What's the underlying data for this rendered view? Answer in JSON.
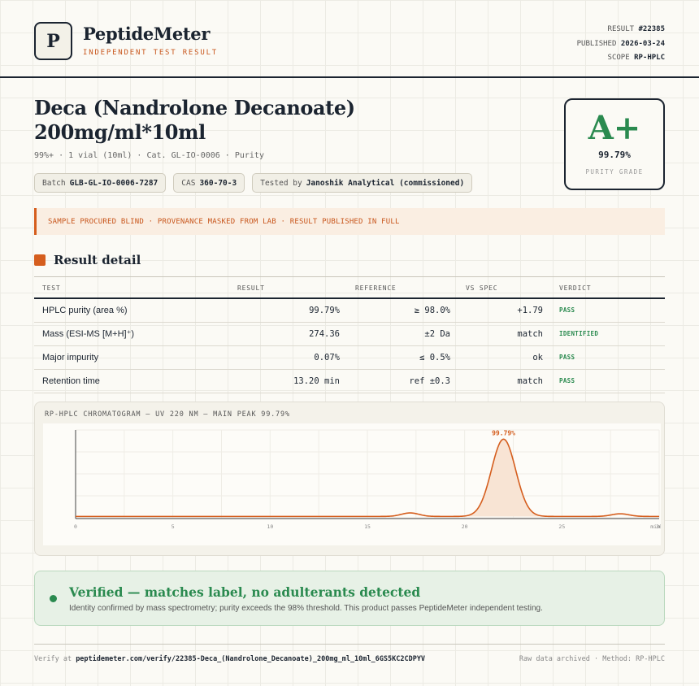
{
  "brand": {
    "logo_letter": "P",
    "name": "PeptideMeter",
    "subtitle": "INDEPENDENT TEST RESULT"
  },
  "meta": {
    "result_label": "RESULT",
    "result_value": "#22385",
    "published_label": "PUBLISHED",
    "published_value": "2026-03-24",
    "scope_label": "SCOPE",
    "scope_value": "RP-HPLC"
  },
  "product": {
    "title_line1": "Deca (Nandrolone Decanoate)",
    "title_line2": "200mg/ml*10ml",
    "subline": "99%+ · 1 vial (10ml) · Cat. GL-IO-0006 · Purity"
  },
  "chips": {
    "batch_label": "Batch",
    "batch_value": "GLB-GL-IO-0006-7287",
    "cas_label": "CAS",
    "cas_value": "360-70-3",
    "tested_label": "Tested by",
    "tested_value": "Janoshik Analytical (commissioned)"
  },
  "grade": {
    "letter": "A+",
    "value": "99.79%",
    "label": "PURITY GRADE",
    "color": "#2a8a4f"
  },
  "notice": "SAMPLE PROCURED BLIND · PROVENANCE MASKED FROM LAB · RESULT PUBLISHED IN FULL",
  "section_title": "Result detail",
  "table": {
    "headers": {
      "test": "TEST",
      "result": "RESULT",
      "reference": "REFERENCE",
      "vs_spec": "VS SPEC",
      "verdict": "VERDICT"
    },
    "rows": [
      {
        "test": "HPLC purity (area %)",
        "result": "99.79%",
        "reference": "≥ 98.0%",
        "vs_spec": "+1.79",
        "verdict": "PASS"
      },
      {
        "test": "Mass (ESI-MS [M+H]⁺)",
        "result": "274.36",
        "reference": "±2 Da",
        "vs_spec": "match",
        "verdict": "IDENTIFIED"
      },
      {
        "test": "Major impurity",
        "result": "0.07%",
        "reference": "≤ 0.5%",
        "vs_spec": "ok",
        "verdict": "PASS"
      },
      {
        "test": "Retention time",
        "result": "13.20 min",
        "reference": "ref ±0.3",
        "vs_spec": "match",
        "verdict": "PASS"
      }
    ]
  },
  "chart_data": {
    "type": "line",
    "title": "RP-HPLC CHROMATOGRAM — UV 220 NM — MAIN PEAK 99.79%",
    "xlabel": "",
    "ylabel": "",
    "x_ticks": [
      "0",
      "5",
      "10",
      "15",
      "20",
      "25",
      "30"
    ],
    "x_unit_label": "min",
    "xlim": [
      0,
      30
    ],
    "ylim": [
      0,
      100
    ],
    "grid": true,
    "line_color": "#d55e1e",
    "peak_label": "99.79%",
    "series": [
      {
        "peaks": [
          {
            "center": 17.2,
            "height": 4
          },
          {
            "center": 22.0,
            "height": 88
          },
          {
            "center": 28.0,
            "height": 3
          }
        ],
        "baseline": 1.5
      }
    ]
  },
  "verified": {
    "title": "Verified — matches label, no adulterants detected",
    "text": "Identity confirmed by mass spectrometry; purity exceeds the 98% threshold. This product passes PeptideMeter independent testing.",
    "color": "#2a8a4f"
  },
  "footer": {
    "verify_label": "Verify at",
    "verify_url": "peptidemeter.com/verify/22385-Deca_(Nandrolone_Decanoate)_200mg_ml_10ml_6GS5KC2CDPYV",
    "right": "Raw data archived · Method: RP-HPLC"
  }
}
